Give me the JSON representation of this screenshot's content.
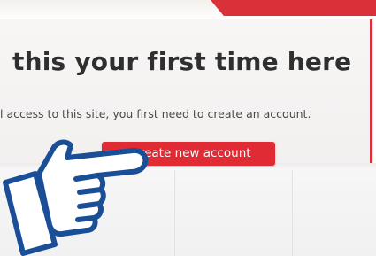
{
  "signup": {
    "heading": "this your first time here",
    "description": "l access to this site, you first need to create an account.",
    "create_button_label": "Create new account"
  },
  "pointer": {
    "icon": "pointing-hand-icon"
  },
  "colors": {
    "accent_red": "#e02b35",
    "heading_text": "#2f2f2f",
    "hand_outline": "#1a4f98"
  }
}
